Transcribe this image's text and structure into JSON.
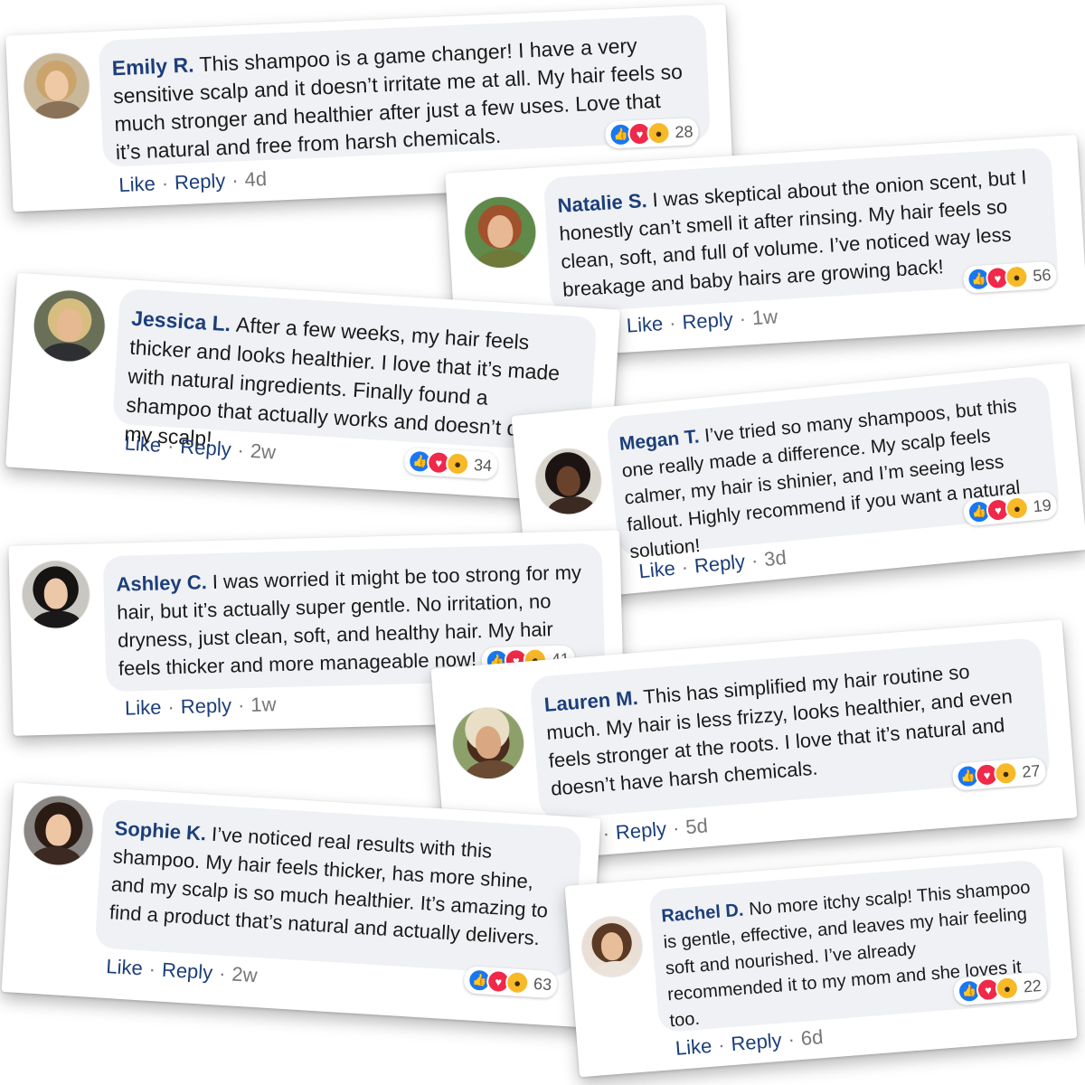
{
  "action_labels": {
    "like": "Like",
    "reply": "Reply"
  },
  "reaction_icons": [
    "like-icon",
    "love-icon",
    "wow-icon"
  ],
  "colors": {
    "name": "#1c3e7a",
    "bubble": "#eff1f4",
    "like": "#1877f2",
    "love": "#f02849",
    "wow": "#f7b928"
  },
  "comments": [
    {
      "name": "Emily R.",
      "text": "This shampoo is a game changer! I have a very sensitive scalp and it doesn’t irritate me at all. My hair feels so much stronger and healthier after just a few uses. Love that it’s natural and free from harsh chemicals.",
      "reactions": "28",
      "age": "4d"
    },
    {
      "name": "Natalie S.",
      "text": "I was skeptical about the onion scent, but I honestly can’t smell it after rinsing. My hair feels so clean, soft, and full of volume. I’ve noticed way less breakage and baby hairs are growing back!",
      "reactions": "56",
      "age": "1w"
    },
    {
      "name": "Jessica L.",
      "text": "After a few weeks, my hair feels thicker and looks healthier. I love that it’s made with natural ingredients. Finally found a shampoo that actually works and doesn’t dry out my scalp!",
      "reactions": "34",
      "age": "2w"
    },
    {
      "name": "Megan T.",
      "text": "I’ve tried so many shampoos, but this one really made a difference. My scalp feels calmer, my hair is shinier, and I’m seeing less fallout. Highly recommend if you want a natural solution!",
      "reactions": "19",
      "age": "3d"
    },
    {
      "name": "Ashley C.",
      "text": "I was worried it might be too strong for my hair, but it’s actually super gentle. No irritation, no dryness, just clean, soft, and healthy hair. My hair feels thicker and more manageable now!",
      "reactions": "41",
      "age": "1w"
    },
    {
      "name": "Lauren M.",
      "text": "This has simplified my hair routine so much. My hair is less frizzy, looks healthier, and even feels stronger at the roots. I love that it’s natural and doesn’t have harsh chemicals.",
      "reactions": "27",
      "age": "5d"
    },
    {
      "name": "Sophie K.",
      "text": "I’ve noticed real results with this shampoo. My hair feels thicker, has more shine, and my scalp is so much healthier. It’s amazing to find a product that’s natural and actually delivers.",
      "reactions": "63",
      "age": "2w"
    },
    {
      "name": "Rachel D.",
      "text": "No more itchy scalp! This shampoo is gentle, effective, and leaves my hair feeling soft and nourished. I’ve already recommended it to my mom and she loves it too.",
      "reactions": "22",
      "age": "6d"
    }
  ]
}
